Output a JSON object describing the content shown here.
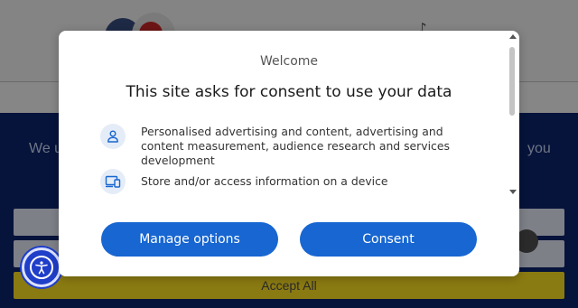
{
  "background": {
    "music_glyph": "♪",
    "intro_left": "We u",
    "intro_right": "you",
    "accept_all_label": "Accept All"
  },
  "accessibility": {
    "icon": "accessibility-icon"
  },
  "dialog": {
    "welcome": "Welcome",
    "title": "This site asks for consent to use your data",
    "purposes": [
      {
        "icon": "person-icon",
        "text": "Personalised advertising and content, advertising and content measurement, audience research and services development"
      },
      {
        "icon": "devices-icon",
        "text": "Store and/or access information on a device"
      }
    ],
    "buttons": {
      "manage_label": "Manage options",
      "consent_label": "Consent"
    }
  },
  "colors": {
    "primary_button": "#1766d1",
    "icon_bg": "#e4ecf7",
    "accessibility": "#1f3ec9",
    "overlay_panel": "#06133b"
  }
}
